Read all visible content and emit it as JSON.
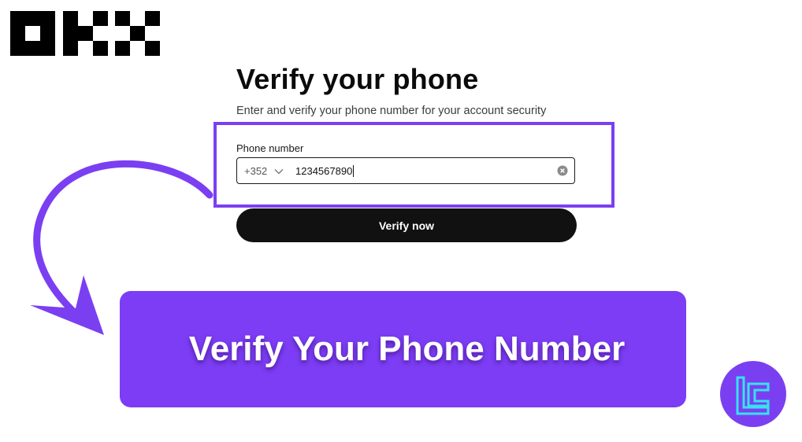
{
  "logo": {
    "name": "okx-logo"
  },
  "page": {
    "title": "Verify your phone",
    "subtitle": "Enter and verify your phone number for your account security"
  },
  "form": {
    "phone_label": "Phone number",
    "country_code": "+352",
    "phone_value": "1234567890",
    "submit_label": "Verify now"
  },
  "banner": {
    "text": "Verify Your Phone Number"
  },
  "colors": {
    "accent": "#7c3df4",
    "button": "#111111",
    "highlight_border": "#7b3ff2"
  },
  "icons": [
    "chevron-down-icon",
    "clear-icon",
    "curved-arrow-icon",
    "brand-badge-icon"
  ]
}
